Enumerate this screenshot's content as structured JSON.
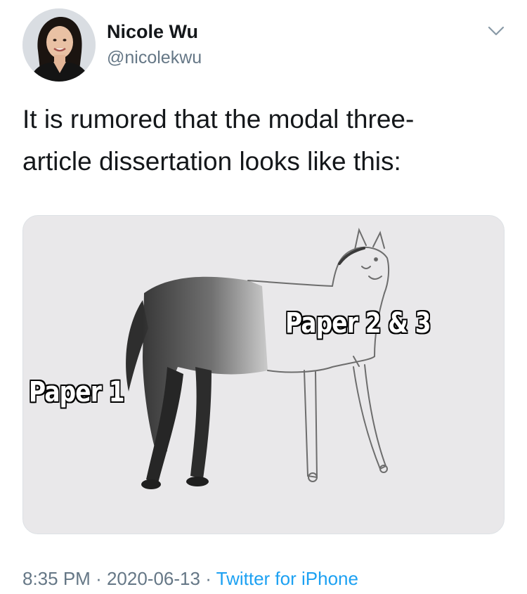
{
  "author": {
    "display_name": "Nicole Wu",
    "handle": "@nicolekwu"
  },
  "tweet": {
    "text_line_1": "It is rumored that the modal three-",
    "text_line_2": "article dissertation looks like this:"
  },
  "media": {
    "caption_1": "Paper 1",
    "caption_2": "Paper 2 & 3"
  },
  "footer": {
    "time": "8:35 PM",
    "separator": "·",
    "date": "2020-06-13",
    "source": "Twitter for iPhone"
  },
  "icons": {
    "menu": "chevron-down-icon"
  },
  "colors": {
    "link": "#1da1f2",
    "secondary_text": "#657786",
    "primary_text": "#14171a"
  }
}
